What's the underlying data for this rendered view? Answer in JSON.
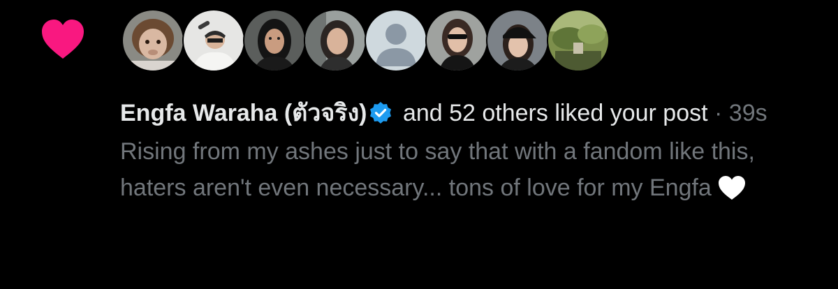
{
  "notification": {
    "type_icon": "heart-icon",
    "type_icon_color": "#f91880",
    "avatars": [
      {
        "icon": "avatar-monkey",
        "ring": "#ffffff"
      },
      {
        "icon": "avatar-person-drinking",
        "ring": "#ffffff"
      },
      {
        "icon": "avatar-woman-dark-hair",
        "ring": "#ffffff"
      },
      {
        "icon": "avatar-woman-selfie",
        "ring": "#ffffff"
      },
      {
        "icon": "avatar-default-placeholder",
        "ring": "#ffffff"
      },
      {
        "icon": "avatar-woman-sunglasses",
        "ring": "#ffffff"
      },
      {
        "icon": "avatar-woman-cap",
        "ring": "#ffffff"
      },
      {
        "icon": "avatar-garden-scene",
        "ring": "#ffffff"
      }
    ],
    "liker_name": "Engfa Waraha (ตัวจริง)",
    "verified_icon": "verified-badge-icon",
    "verified_color": "#1d9bf0",
    "action_text": " and 52 others liked your post",
    "separator": " · ",
    "time_ago": "39s",
    "post_text": "Rising from my ashes just to say that with a fandom like this, haters aren't even necessary... tons of love for my Engfa",
    "post_emoji": "white-heart-icon"
  }
}
